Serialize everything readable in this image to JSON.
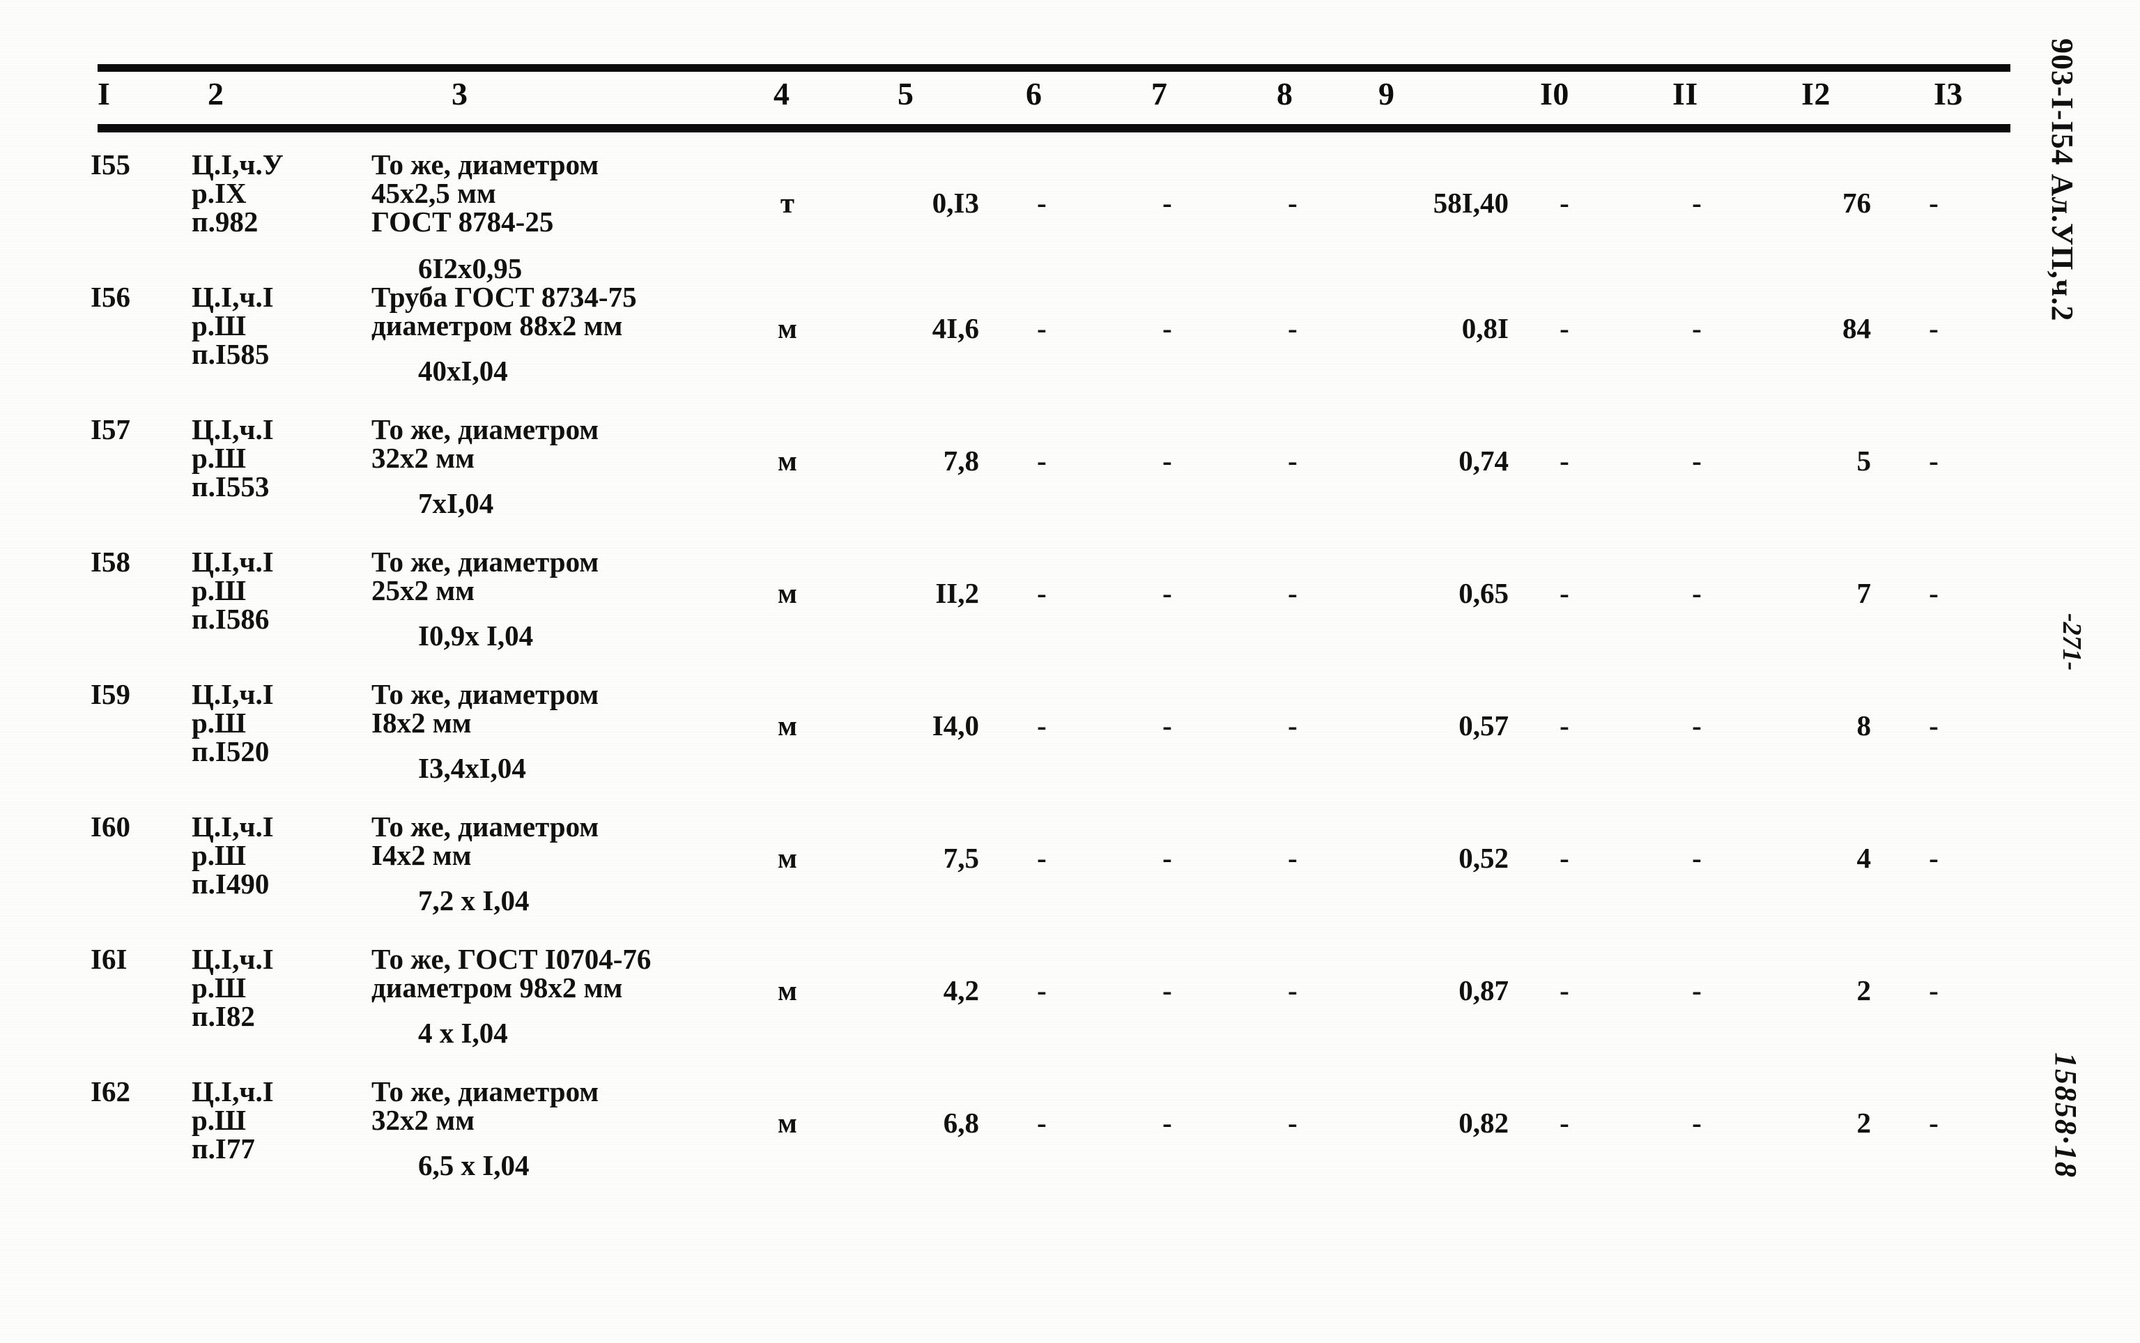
{
  "document": {
    "doc_code": "903-I-I54 Ал.УП,ч.2",
    "page_number": "-271-",
    "archive_code": "15858·18"
  },
  "table": {
    "column_headers": [
      "I",
      "2",
      "3",
      "4",
      "5",
      "6",
      "7",
      "8",
      "9",
      "I0",
      "II",
      "I2",
      "I3"
    ],
    "rows": [
      {
        "num": "I55",
        "ref_l1": "Ц.I,ч.У",
        "ref_l2": "р.IX",
        "ref_l3": "п.982",
        "desc_l1": "То же, диаметром",
        "desc_l2": "45х2,5 мм",
        "desc_l3": "ГОСТ 8784-25",
        "desc_calc": "6I2х0,95",
        "unit": "т",
        "qty": "0,I3",
        "c6": "-",
        "c7": "-",
        "c8": "-",
        "c9": "58I,40",
        "c10": "-",
        "c11": "-",
        "c12": "76",
        "c13": "-"
      },
      {
        "num": "I56",
        "ref_l1": "Ц.I,ч.I",
        "ref_l2": "р.Ш",
        "ref_l3": "п.I585",
        "desc_l1": "Труба ГОСТ 8734-75",
        "desc_l2": "диаметром 88х2 мм",
        "desc_l3": "",
        "desc_calc": "40хI,04",
        "unit": "м",
        "qty": "4I,6",
        "c6": "-",
        "c7": "-",
        "c8": "-",
        "c9": "0,8I",
        "c10": "-",
        "c11": "-",
        "c12": "84",
        "c13": "-"
      },
      {
        "num": "I57",
        "ref_l1": "Ц.I,ч.I",
        "ref_l2": "р.Ш",
        "ref_l3": "п.I553",
        "desc_l1": "То же, диаметром",
        "desc_l2": "32х2 мм",
        "desc_l3": "",
        "desc_calc": "7хI,04",
        "unit": "м",
        "qty": "7,8",
        "c6": "-",
        "c7": "-",
        "c8": "-",
        "c9": "0,74",
        "c10": "-",
        "c11": "-",
        "c12": "5",
        "c13": "-"
      },
      {
        "num": "I58",
        "ref_l1": "Ц.I,ч.I",
        "ref_l2": "р.Ш",
        "ref_l3": "п.I586",
        "desc_l1": "То же, диаметром",
        "desc_l2": "25х2 мм",
        "desc_l3": "",
        "desc_calc": "I0,9х I,04",
        "unit": "м",
        "qty": "II,2",
        "c6": "-",
        "c7": "-",
        "c8": "-",
        "c9": "0,65",
        "c10": "-",
        "c11": "-",
        "c12": "7",
        "c13": "-"
      },
      {
        "num": "I59",
        "ref_l1": "Ц.I,ч.I",
        "ref_l2": "р.Ш",
        "ref_l3": "п.I520",
        "desc_l1": "То же, диаметром",
        "desc_l2": "I8х2 мм",
        "desc_l3": "",
        "desc_calc": "I3,4хI,04",
        "unit": "м",
        "qty": "I4,0",
        "c6": "-",
        "c7": "-",
        "c8": "-",
        "c9": "0,57",
        "c10": "-",
        "c11": "-",
        "c12": "8",
        "c13": "-"
      },
      {
        "num": "I60",
        "ref_l1": "Ц.I,ч.I",
        "ref_l2": "р.Ш",
        "ref_l3": "п.I490",
        "desc_l1": "То же, диаметром",
        "desc_l2": "I4х2 мм",
        "desc_l3": "",
        "desc_calc": "7,2 х I,04",
        "unit": "м",
        "qty": "7,5",
        "c6": "-",
        "c7": "-",
        "c8": "-",
        "c9": "0,52",
        "c10": "-",
        "c11": "-",
        "c12": "4",
        "c13": "-"
      },
      {
        "num": "I6I",
        "ref_l1": "Ц.I,ч.I",
        "ref_l2": "р.Ш",
        "ref_l3": "п.I82",
        "desc_l1": "То же, ГОСТ I0704-76",
        "desc_l2": "диаметром 98х2 мм",
        "desc_l3": "",
        "desc_calc": "4 х I,04",
        "unit": "м",
        "qty": "4,2",
        "c6": "-",
        "c7": "-",
        "c8": "-",
        "c9": "0,87",
        "c10": "-",
        "c11": "-",
        "c12": "2",
        "c13": "-"
      },
      {
        "num": "I62",
        "ref_l1": "Ц.I,ч.I",
        "ref_l2": "р.Ш",
        "ref_l3": "п.I77",
        "desc_l1": "То же, диаметром",
        "desc_l2": "32х2 мм",
        "desc_l3": "",
        "desc_calc": "6,5 х I,04",
        "unit": "м",
        "qty": "6,8",
        "c6": "-",
        "c7": "-",
        "c8": "-",
        "c9": "0,82",
        "c10": "-",
        "c11": "-",
        "c12": "2",
        "c13": "-"
      }
    ]
  }
}
